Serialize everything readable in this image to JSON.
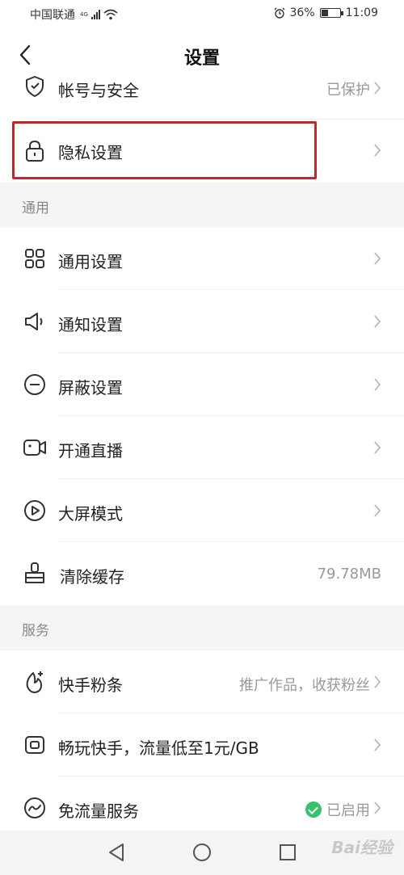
{
  "status_bar": {
    "carrier": "中国联通",
    "network": "4G",
    "battery": "36%",
    "battery_level": 0.36,
    "time": "11:09"
  },
  "header": {
    "title": "设置"
  },
  "top_items": [
    {
      "label": "帐号与安全",
      "value": "已保护",
      "icon": "shield-icon"
    },
    {
      "label": "隐私设置",
      "value": "",
      "icon": "lock-icon"
    }
  ],
  "sections": [
    {
      "title": "通用",
      "items": [
        {
          "label": "通用设置",
          "value": "",
          "icon": "grid-icon"
        },
        {
          "label": "通知设置",
          "value": "",
          "icon": "speaker-icon"
        },
        {
          "label": "屏蔽设置",
          "value": "",
          "icon": "block-icon"
        },
        {
          "label": "开通直播",
          "value": "",
          "icon": "camera-icon"
        },
        {
          "label": "大屏模式",
          "value": "",
          "icon": "play-icon"
        },
        {
          "label": "清除缓存",
          "value": "79.78MB",
          "icon": "brush-icon"
        }
      ]
    },
    {
      "title": "服务",
      "items": [
        {
          "label": "快手粉条",
          "value": "推广作品，收获粉丝",
          "icon": "fan-icon"
        },
        {
          "label": "畅玩快手，流量低至1元/GB",
          "value": "",
          "icon": "card-icon"
        },
        {
          "label": "免流量服务",
          "value": "已启用",
          "icon": "wave-icon"
        }
      ]
    }
  ],
  "colors": {
    "highlight": "#c0282c",
    "enabled": "#34c26b"
  },
  "watermark": "Bai经验"
}
